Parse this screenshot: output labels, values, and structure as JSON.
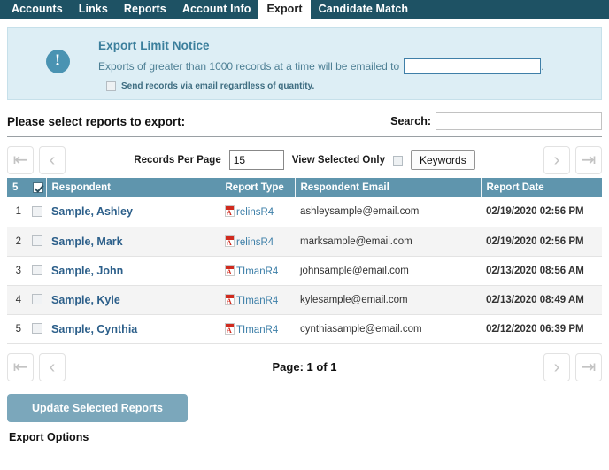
{
  "nav": {
    "tabs": [
      {
        "label": "Accounts",
        "active": false
      },
      {
        "label": "Links",
        "active": false
      },
      {
        "label": "Reports",
        "active": false
      },
      {
        "label": "Account Info",
        "active": false
      },
      {
        "label": "Export",
        "active": true
      },
      {
        "label": "Candidate Match",
        "active": false
      }
    ]
  },
  "notice": {
    "icon": "exclamation-icon",
    "title": "Export Limit Notice",
    "text_before": "Exports of greater than 1000 records at a time will be emailed to",
    "text_after": ".",
    "email_value": "",
    "email_placeholder": "",
    "checkbox_label": "Send records via email regardless of quantity.",
    "checkbox_checked": false,
    "bg_color": "#ddeef5",
    "accent_color": "#4a93b2"
  },
  "select_section": {
    "title": "Please select reports to export:",
    "search_label": "Search:",
    "search_value": "",
    "search_placeholder": ""
  },
  "toolbar": {
    "first_label": "|<",
    "prev_label": "<",
    "next_label": ">",
    "last_label": ">|",
    "records_per_page_label": "Records Per Page",
    "records_per_page_value": "15",
    "view_selected_only_label": "View Selected Only",
    "view_selected_only_checked": false,
    "keywords_label": "Keywords"
  },
  "table": {
    "selected_count": "5",
    "select_all_checked": true,
    "columns": [
      "Respondent",
      "Report Type",
      "Respondent Email",
      "Report Date"
    ],
    "rows": [
      {
        "num": "1",
        "checked": false,
        "respondent": "Sample, Ashley",
        "report_type": "relinsR4",
        "email": "ashleysample@email.com",
        "date": "02/19/2020 02:56 PM"
      },
      {
        "num": "2",
        "checked": false,
        "respondent": "Sample, Mark",
        "report_type": "relinsR4",
        "email": "marksample@email.com",
        "date": "02/19/2020 02:56 PM"
      },
      {
        "num": "3",
        "checked": false,
        "respondent": "Sample, John",
        "report_type": "TImanR4",
        "email": "johnsample@email.com",
        "date": "02/13/2020 08:56 AM"
      },
      {
        "num": "4",
        "checked": false,
        "respondent": "Sample, Kyle",
        "report_type": "TImanR4",
        "email": "kylesample@email.com",
        "date": "02/13/2020 08:49 AM"
      },
      {
        "num": "5",
        "checked": false,
        "respondent": "Sample, Cynthia",
        "report_type": "TImanR4",
        "email": "cynthiasample@email.com",
        "date": "02/12/2020 06:39 PM"
      }
    ]
  },
  "footer": {
    "page_indicator": "Page: 1 of 1",
    "update_button": "Update Selected Reports",
    "export_options_label": "Export Options"
  },
  "colors": {
    "navbar": "#1e5264",
    "table_header": "#5f95ad",
    "link": "#2c5f8a",
    "button": "#7ba7bb"
  }
}
